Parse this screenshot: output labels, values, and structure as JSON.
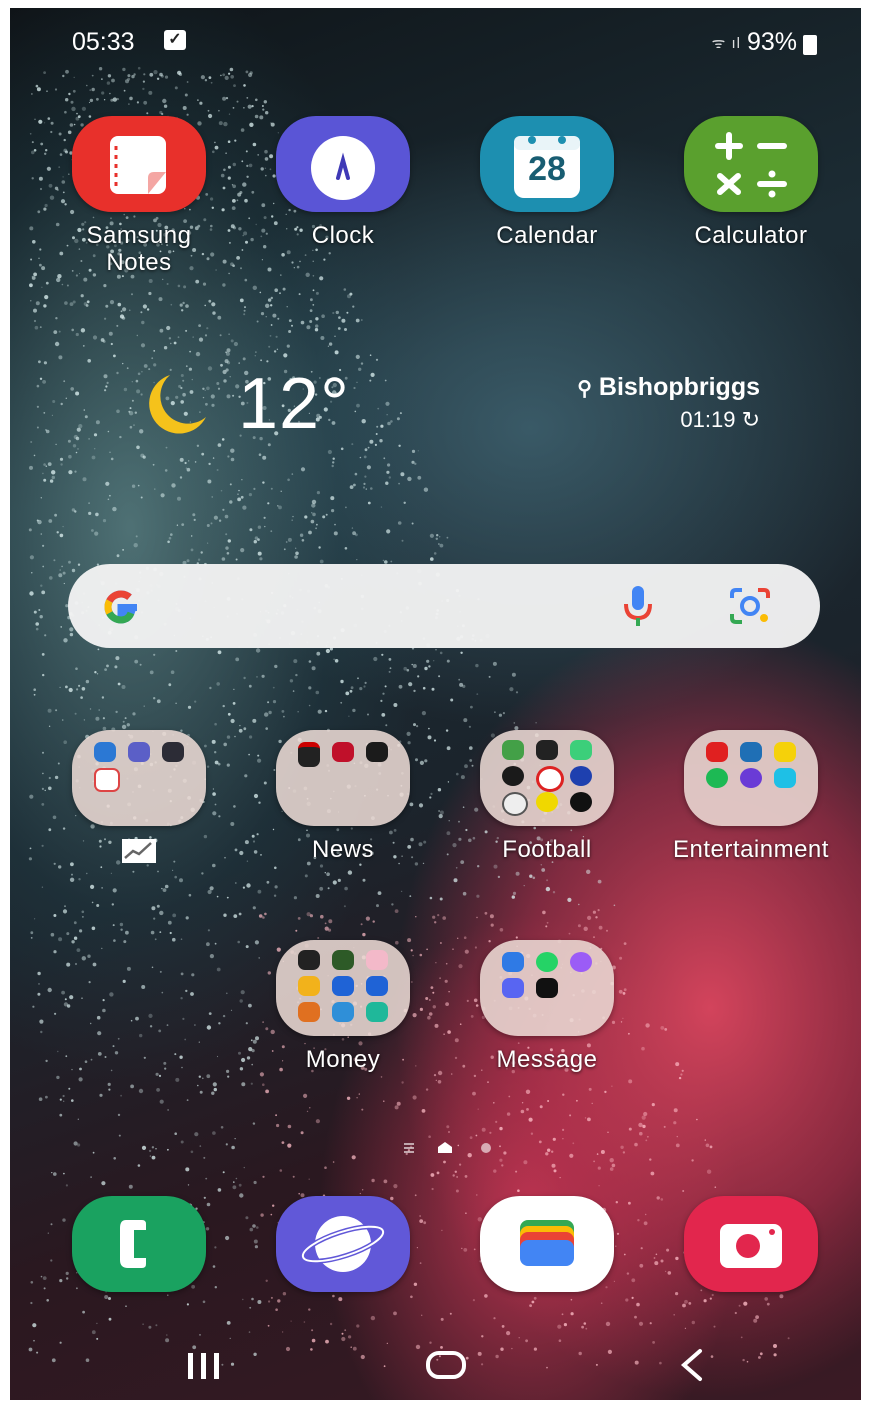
{
  "status_bar": {
    "time": "05:33",
    "battery": "93%"
  },
  "top_apps": [
    {
      "label": "Samsung\nNotes",
      "icon": "samsung-notes-icon",
      "color": "#e8302b"
    },
    {
      "label": "Clock",
      "icon": "clock-icon",
      "color": "#5a55d6"
    },
    {
      "label": "Calendar",
      "icon": "calendar-icon",
      "color": "#1d8fb0",
      "date": "28"
    },
    {
      "label": "Calculator",
      "icon": "calculator-icon",
      "color": "#5aa02e"
    }
  ],
  "weather": {
    "temperature": "12°",
    "location": "Bishopbriggs",
    "updated": "01:19",
    "icon": "moon-icon"
  },
  "search": {
    "icon": "google-g-icon",
    "mic": "microphone-icon",
    "lens": "google-lens-icon"
  },
  "folders_row1": [
    {
      "label": "",
      "icon": "chart-icon"
    },
    {
      "label": "News"
    },
    {
      "label": "Football"
    },
    {
      "label": "Entertainment"
    }
  ],
  "folders_row2": [
    {
      "label": "Money"
    },
    {
      "label": "Message"
    }
  ],
  "dock": [
    {
      "name": "Phone",
      "icon": "phone-icon",
      "color": "#1aa260"
    },
    {
      "name": "Samsung Internet",
      "icon": "internet-icon",
      "color": "#6158d8"
    },
    {
      "name": "Wallet",
      "icon": "wallet-icon",
      "color": "#ffffff"
    },
    {
      "name": "Camera",
      "icon": "camera-icon",
      "color": "#e2264d"
    }
  ],
  "nav": {
    "recents": "recents-icon",
    "home": "home-icon",
    "back": "back-icon"
  }
}
